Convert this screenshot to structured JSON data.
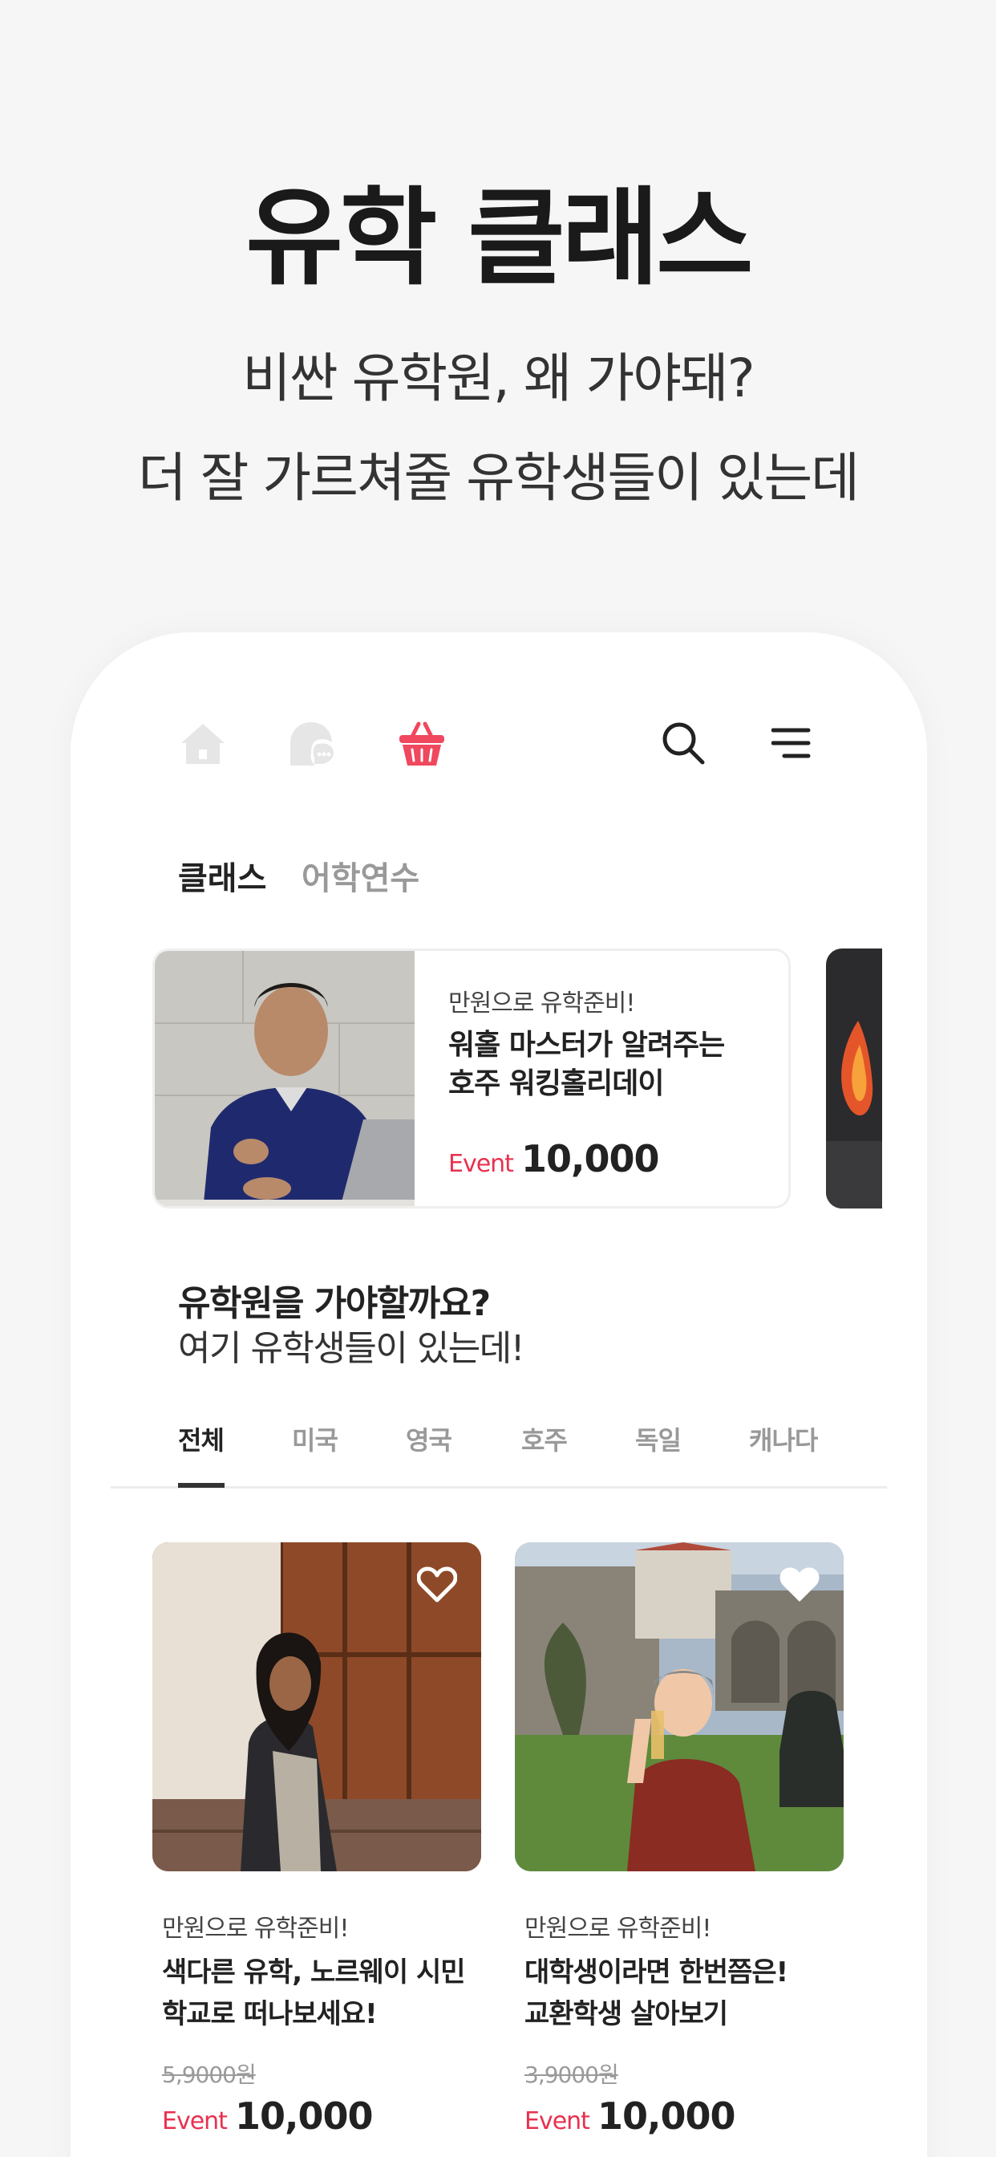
{
  "hero": {
    "title": "유학 클래스",
    "subtitle_line1": "비싼 유학원, 왜 가야돼?",
    "subtitle_line2": "더 잘 가르쳐줄 유학생들이 있는데"
  },
  "nav": {
    "icons": [
      "home-icon",
      "chat-icon",
      "basket-icon",
      "search-icon",
      "menu-icon"
    ],
    "active_color": "#f0485e",
    "inactive_color": "#e6e6e6"
  },
  "top_tabs": [
    {
      "label": "클래스",
      "active": true
    },
    {
      "label": "어학연수",
      "active": false
    }
  ],
  "featured": {
    "eyebrow": "만원으로 유학준비!",
    "title_line1": "워홀 마스터가 알려주는",
    "title_line2": "호주 워킹홀리데이",
    "event_label": "Event",
    "price": "10,000"
  },
  "section": {
    "title": "유학원을 가야할까요?",
    "subtitle": "여기 유학생들이 있는데!"
  },
  "country_tabs": [
    {
      "label": "전체",
      "active": true
    },
    {
      "label": "미국",
      "active": false
    },
    {
      "label": "영국",
      "active": false
    },
    {
      "label": "호주",
      "active": false
    },
    {
      "label": "독일",
      "active": false
    },
    {
      "label": "캐나다",
      "active": false
    }
  ],
  "classes": [
    {
      "eyebrow": "만원으로 유학준비!",
      "title_line1": "색다른 유학, 노르웨이 시민",
      "title_line2": "학교로 떠나보세요!",
      "original_price": "5,9000원",
      "event_label": "Event",
      "price": "10,000",
      "favorite": false
    },
    {
      "eyebrow": "만원으로 유학준비!",
      "title_line1": "대학생이라면 한번쯤은!",
      "title_line2": "교환학생 살아보기",
      "original_price": "3,9000원",
      "event_label": "Event",
      "price": "10,000",
      "favorite": false
    }
  ],
  "colors": {
    "accent": "#e8314f",
    "background": "#f6f6f6"
  }
}
